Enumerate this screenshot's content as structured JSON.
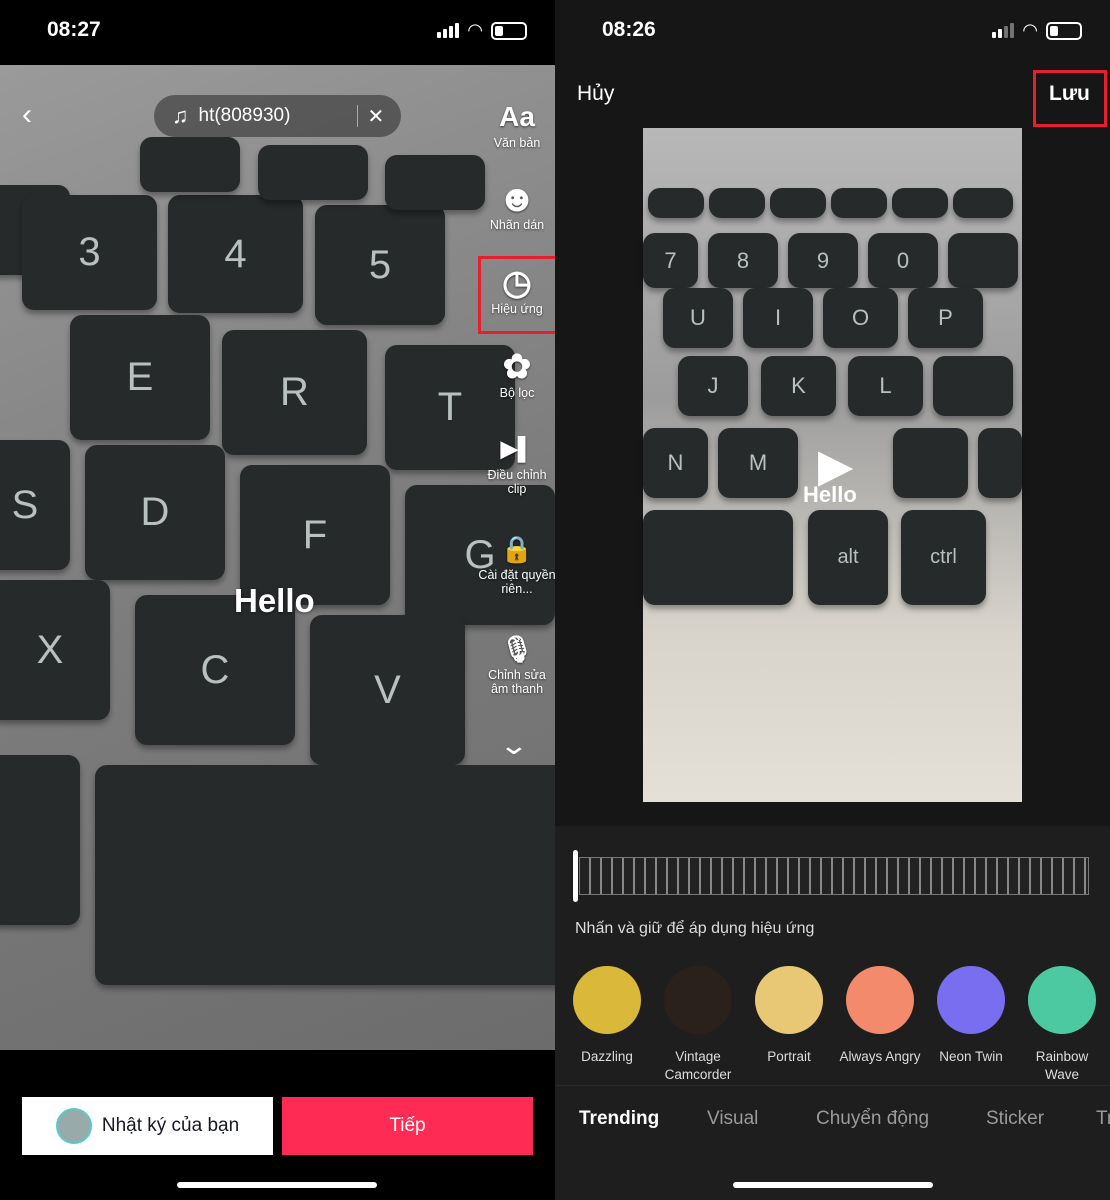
{
  "left": {
    "status": {
      "time": "08:27"
    },
    "music": {
      "title": "ht(808930)"
    },
    "overlay_text": "Hello",
    "tools": [
      {
        "icon": "text-icon",
        "glyph": "Aa",
        "label": "Văn bản"
      },
      {
        "icon": "sticker-icon",
        "glyph": "☻",
        "label": "Nhãn dán"
      },
      {
        "icon": "effects-icon",
        "glyph": "◷",
        "label": "Hiệu ứng"
      },
      {
        "icon": "filter-icon",
        "glyph": "✿",
        "label": "Bộ lọc"
      },
      {
        "icon": "adjust-clip-icon",
        "glyph": "▶▌",
        "label": "Điều chỉnh clip"
      },
      {
        "icon": "lock-icon",
        "glyph": "🔒",
        "label": "Cài đặt quyền riên..."
      },
      {
        "icon": "voice-edit-icon",
        "glyph": "🎙",
        "label": "Chỉnh sửa âm thanh"
      }
    ],
    "diary_button": "Nhật ký của bạn",
    "next_button": "Tiếp"
  },
  "right": {
    "status": {
      "time": "08:26"
    },
    "cancel": "Hủy",
    "save": "Lưu",
    "overlay_text": "Hello",
    "hint": "Nhấn và giữ để áp dụng hiệu ứng",
    "effects": [
      {
        "label": "Dazzling",
        "color": "#d9b83a"
      },
      {
        "label": "Vintage Camcorder",
        "color": "#2a211c"
      },
      {
        "label": "Portrait",
        "color": "#e8c874"
      },
      {
        "label": "Always Angry",
        "color": "#f38a6c"
      },
      {
        "label": "Neon Twin",
        "color": "#7a6ef0"
      },
      {
        "label": "Rainbow Wave",
        "color": "#4cc9a0"
      }
    ],
    "tabs": [
      "Trending",
      "Visual",
      "Chuyển động",
      "Sticker",
      "Tr"
    ],
    "active_tab": "Trending"
  },
  "colors": {
    "accent": "#fe2c55",
    "highlight": "#e5202e"
  }
}
